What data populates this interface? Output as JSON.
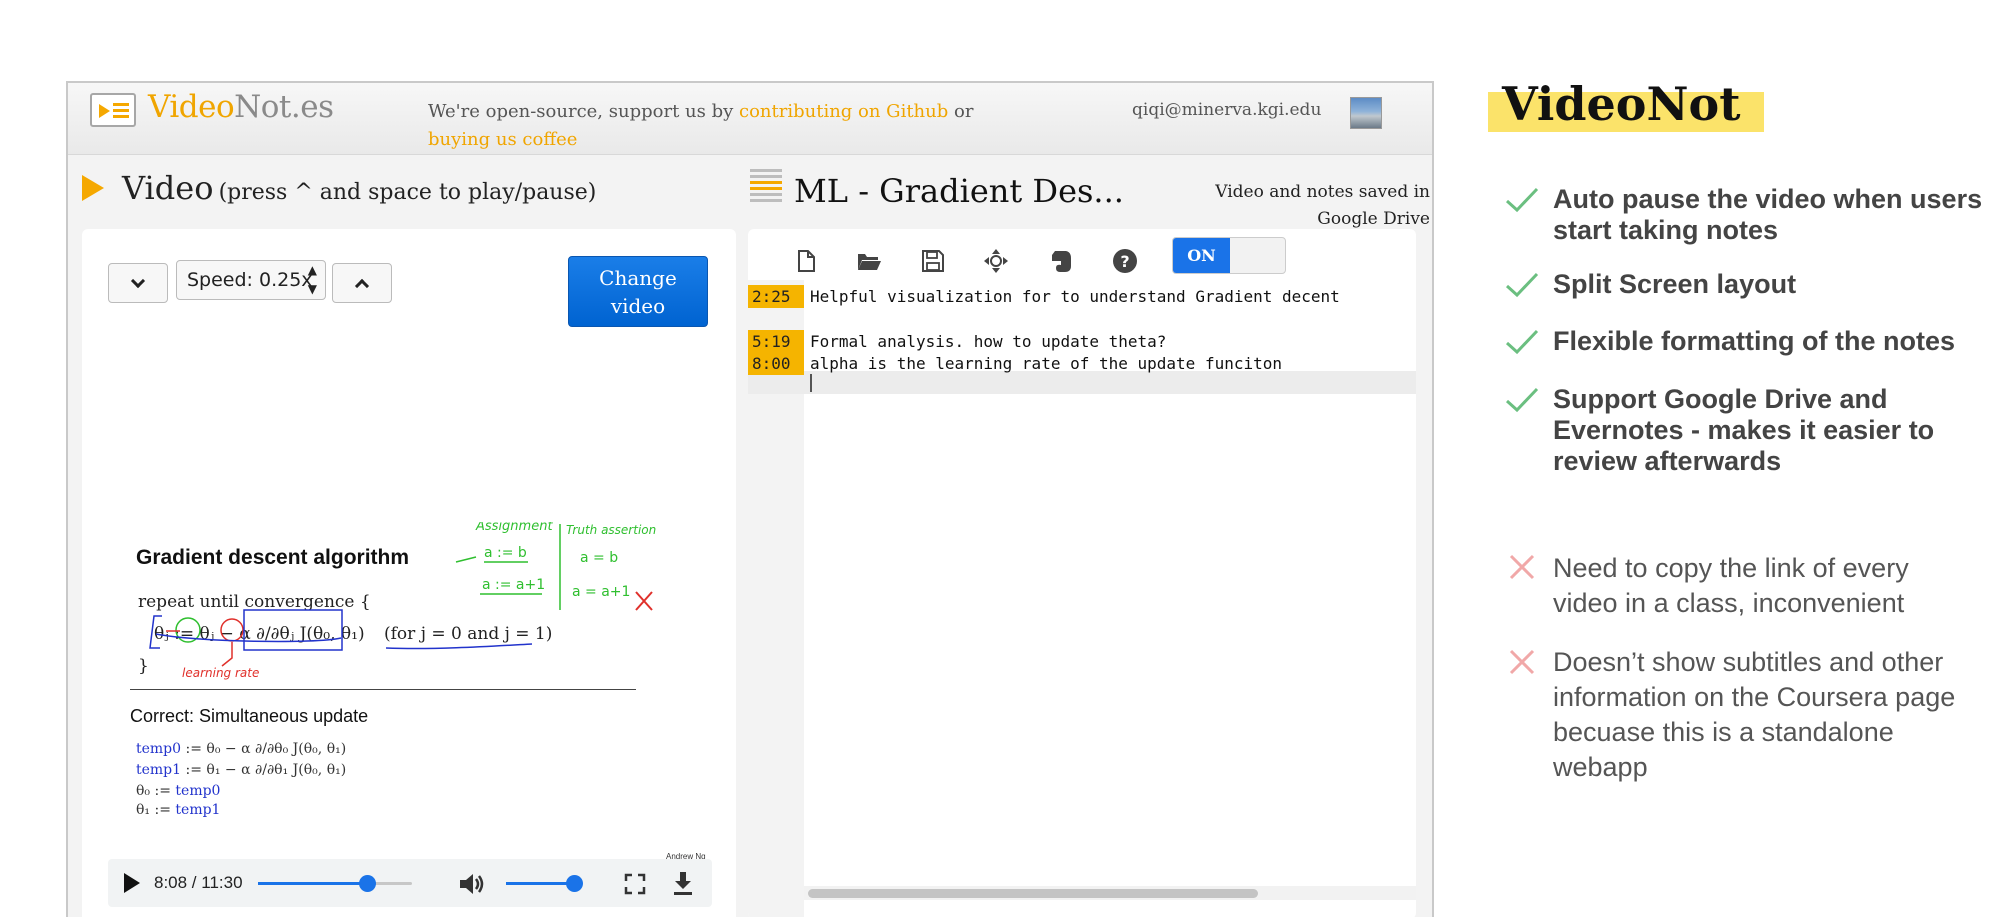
{
  "topbar": {
    "logo_part1": "Video",
    "logo_part2": "Not.es",
    "promo_text": "We're open-source, support us by ",
    "promo_link1": "contributing on Github",
    "promo_or": " or",
    "promo_link2": "buying us coffee",
    "email": "qiqi@minerva.kgi.edu"
  },
  "video_panel": {
    "title": "Video",
    "hint": "(press ^ and space to play/pause)",
    "speed_label": "Speed: 0.25x",
    "change_video_label": "Change video",
    "slide": {
      "heading": "Gradient descent algorithm",
      "repeat": "repeat until convergence {",
      "update_rule": "θⱼ := θⱼ − α ∂/∂θⱼ J(θ₀, θ₁)",
      "condition": "(for j = 0 and j = 1)",
      "close_brace": "}",
      "subheading": "Correct: Simultaneous update",
      "eq1_var": "temp0",
      "eq1_rhs": ":= θ₀ − α ∂/∂θ₀ J(θ₀, θ₁)",
      "eq2_var": "temp1",
      "eq2_rhs": ":= θ₁ − α ∂/∂θ₁ J(θ₀, θ₁)",
      "eq3_lhs": "θ₀ :=",
      "eq3_var": "temp0",
      "eq4_lhs": "θ₁ :=",
      "eq4_var": "temp1",
      "credit": "Andrew Ng",
      "ann_assignment": "Assignment",
      "ann_a_eq_b": "a := b",
      "ann_a_eq_a1": "a := a+1",
      "ann_truth": "Truth assertion",
      "ann_truth_ab": "a = b",
      "ann_truth_a1": "a = a+1",
      "ann_lr": "learning rate"
    },
    "player": {
      "time": "8:08 / 11:30",
      "progress_fraction": 0.71,
      "volume_fraction": 0.9
    }
  },
  "notes_panel": {
    "title": "ML - Gradient Des...",
    "saved_line1": "Video and notes saved in",
    "saved_line2": "Google Drive",
    "toggle_label": "ON",
    "notes": [
      {
        "timestamp": "2:25",
        "text": "Helpful visualization for to understand Gradient decent"
      },
      {
        "timestamp": "5:19",
        "text": "Formal analysis. how to update theta?"
      },
      {
        "timestamp": "8:00",
        "text": "alpha is the learning rate of the update funciton"
      }
    ]
  },
  "features": {
    "brand": "VideoNot",
    "pros": [
      "Auto pause the video when users start taking notes",
      "Split Screen layout",
      "Flexible formatting of the notes",
      "Support Google Drive and Evernotes - makes it easier to review afterwards"
    ],
    "cons": [
      "Need to copy the link of every video in a class, inconvenient",
      "Doesn’t show subtitles and other information on the Coursera page becuase this is a standalone webapp"
    ],
    "colors": {
      "check": "#6bbf80",
      "cross": "#f1a8a8",
      "highlight": "#fbe36a",
      "accent": "#f0a500"
    }
  }
}
